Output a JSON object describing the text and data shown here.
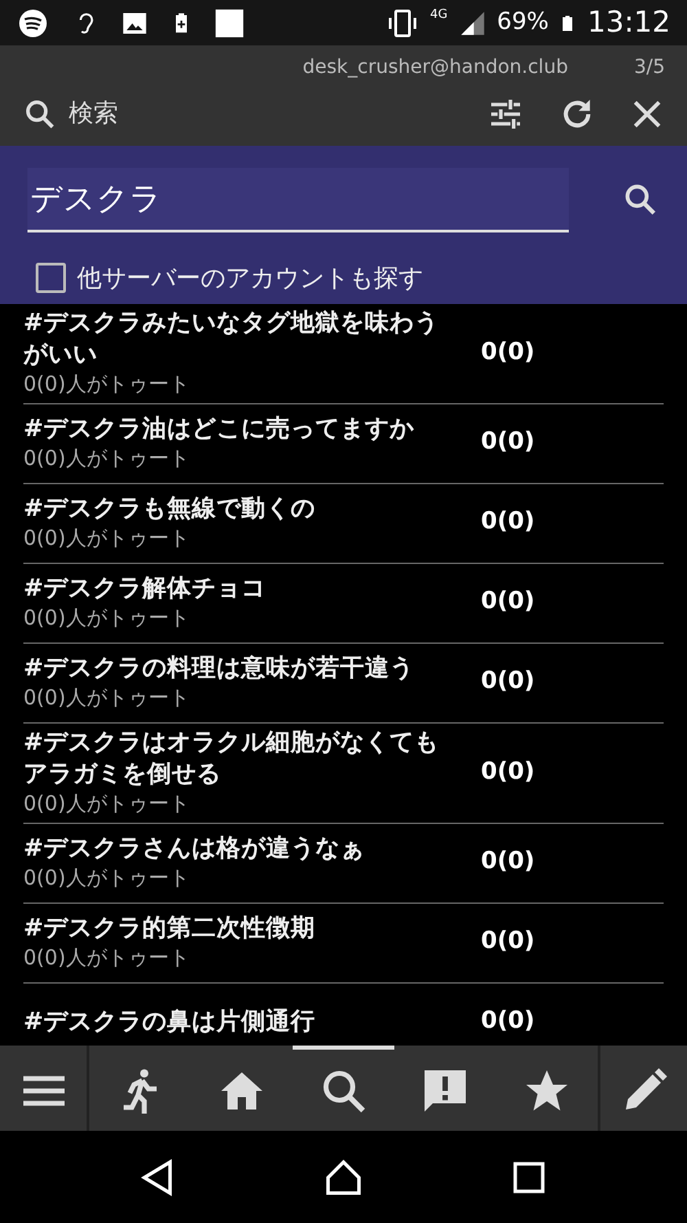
{
  "status_bar": {
    "network": "4G",
    "battery": "69%",
    "time": "13:12"
  },
  "header": {
    "account": "desk_crusher@handon.club",
    "page": "3/5",
    "title": "検索"
  },
  "search": {
    "value": "デスクラ",
    "other_servers": {
      "label": "他サーバーのアカウントも探す",
      "checked": false
    }
  },
  "results": [
    {
      "tag": "#デスクラみたいなタグ地獄を味わうがいい",
      "people": "0(0)人がトゥート",
      "count": "0(0)"
    },
    {
      "tag": "#デスクラ油はどこに売ってますか",
      "people": "0(0)人がトゥート",
      "count": "0(0)"
    },
    {
      "tag": "#デスクラも無線で動くの",
      "people": "0(0)人がトゥート",
      "count": "0(0)"
    },
    {
      "tag": "#デスクラ解体チョコ",
      "people": "0(0)人がトゥート",
      "count": "0(0)"
    },
    {
      "tag": "#デスクラの料理は意味が若干違う",
      "people": "0(0)人がトゥート",
      "count": "0(0)"
    },
    {
      "tag": "#デスクラはオラクル細胞がなくてもアラガミを倒せる",
      "people": "0(0)人がトゥート",
      "count": "0(0)"
    },
    {
      "tag": "#デスクラさんは格が違うなぁ",
      "people": "0(0)人がトゥート",
      "count": "0(0)"
    },
    {
      "tag": "#デスクラ的第二次性徴期",
      "people": "0(0)人がトゥート",
      "count": "0(0)"
    },
    {
      "tag": "#デスクラの鼻は片側通行",
      "count": "0(0)"
    }
  ],
  "bottom_tabs": [
    {
      "kind": "menu",
      "selected": false
    },
    {
      "kind": "run",
      "selected": false
    },
    {
      "kind": "home",
      "selected": false
    },
    {
      "kind": "search",
      "selected": true
    },
    {
      "kind": "alert",
      "selected": false
    },
    {
      "kind": "star",
      "selected": false
    },
    {
      "kind": "pencil",
      "selected": false
    }
  ]
}
